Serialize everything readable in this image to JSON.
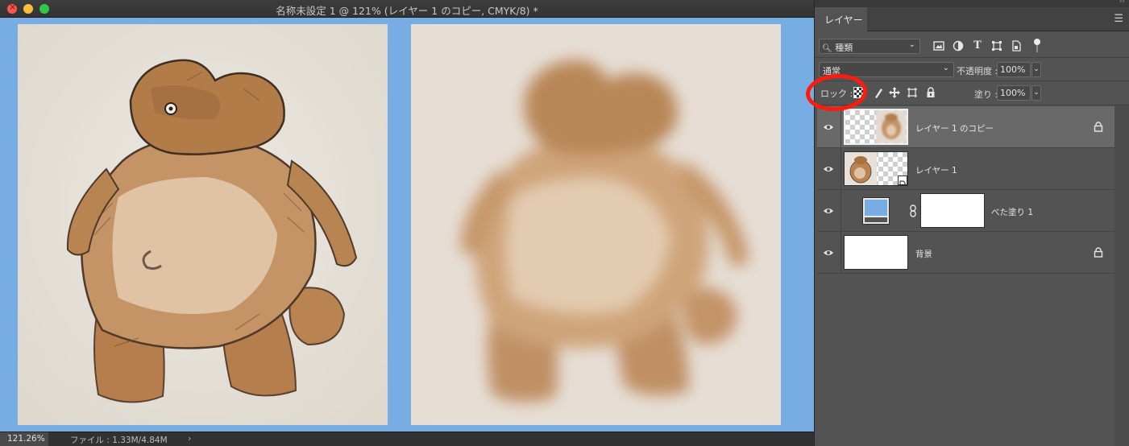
{
  "window": {
    "title": "名称未設定 1 @ 121% (レイヤー 1 のコピー, CMYK/8) *"
  },
  "status": {
    "zoom": "121.26%",
    "file_info": "ファイル : 1.33M/4.84M",
    "arrow": "›"
  },
  "canvas": {
    "background_color": "#78ade3",
    "left_image": "bear-drawing-sharp",
    "right_image": "bear-drawing-blurred"
  },
  "panel": {
    "tab_label": "レイヤー",
    "menu_icon": "panel-menu-icon",
    "collapse_icon": "››",
    "filter": {
      "kind_label": "種類",
      "icons": [
        "image-filter-icon",
        "adjustment-filter-icon",
        "type-filter-icon",
        "shape-filter-icon",
        "smart-object-filter-icon"
      ]
    },
    "blend_mode": "通常",
    "opacity_label": "不透明度 :",
    "opacity_value": "100%",
    "lock_label": "ロック :",
    "fill_label": "塗り :",
    "fill_value": "100%",
    "highlight_color": "#ff1a0e"
  },
  "layers": [
    {
      "name": "レイヤー 1 のコピー",
      "visible": true,
      "selected": true,
      "locked": true,
      "thumb": "checker-bear-blurred"
    },
    {
      "name": "レイヤー 1",
      "visible": true,
      "selected": false,
      "locked": false,
      "thumb": "checker-bear-smartobject"
    },
    {
      "name": "べた塗り 1",
      "visible": true,
      "selected": false,
      "locked": false,
      "thumb": "solid-fill",
      "fill_color": "#78ade3"
    },
    {
      "name": "背景",
      "visible": true,
      "selected": false,
      "locked": true,
      "thumb": "white"
    }
  ]
}
